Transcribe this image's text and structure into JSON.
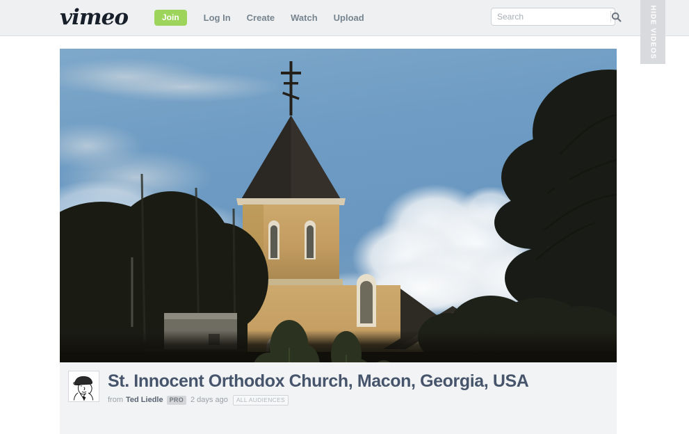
{
  "header": {
    "logo_text": "vimeo",
    "join_label": "Join",
    "nav_items": [
      {
        "label": "Log In",
        "name": "nav-login"
      },
      {
        "label": "Create",
        "name": "nav-create"
      },
      {
        "label": "Watch",
        "name": "nav-watch"
      },
      {
        "label": "Upload",
        "name": "nav-upload"
      }
    ],
    "search": {
      "placeholder": "Search",
      "value": "",
      "icon": "search-icon"
    },
    "hide_videos_label": "HIDE VIDEOS",
    "colors": {
      "background": "#eff0f2",
      "join_green": "#9dd45c",
      "nav_link": "#76848f",
      "logo": "#17202a"
    }
  },
  "video": {
    "title": "St. Innocent Orthodox Church, Macon, Georgia, USA",
    "from_label": "from",
    "author": "Ted Liedle",
    "pro_badge": "PRO",
    "uploaded": "2 days ago",
    "audience_badge": "ALL AUDIENCES",
    "avatar_alt": "man-in-flat-cap-drawing",
    "thumbnail_description": "Orthodox church with tan stucco walls, dark conical tower roof and three-bar cross, blue sky with white cumulus cloud, silhouetted trees and a white car at lower left",
    "colors": {
      "title": "#46556b",
      "info_background": "#f2f3f5",
      "meta_text": "#9aa0a6",
      "sky": "#6f9bc4",
      "church_wall": "#c9a368",
      "roof": "#2e2a26"
    }
  }
}
